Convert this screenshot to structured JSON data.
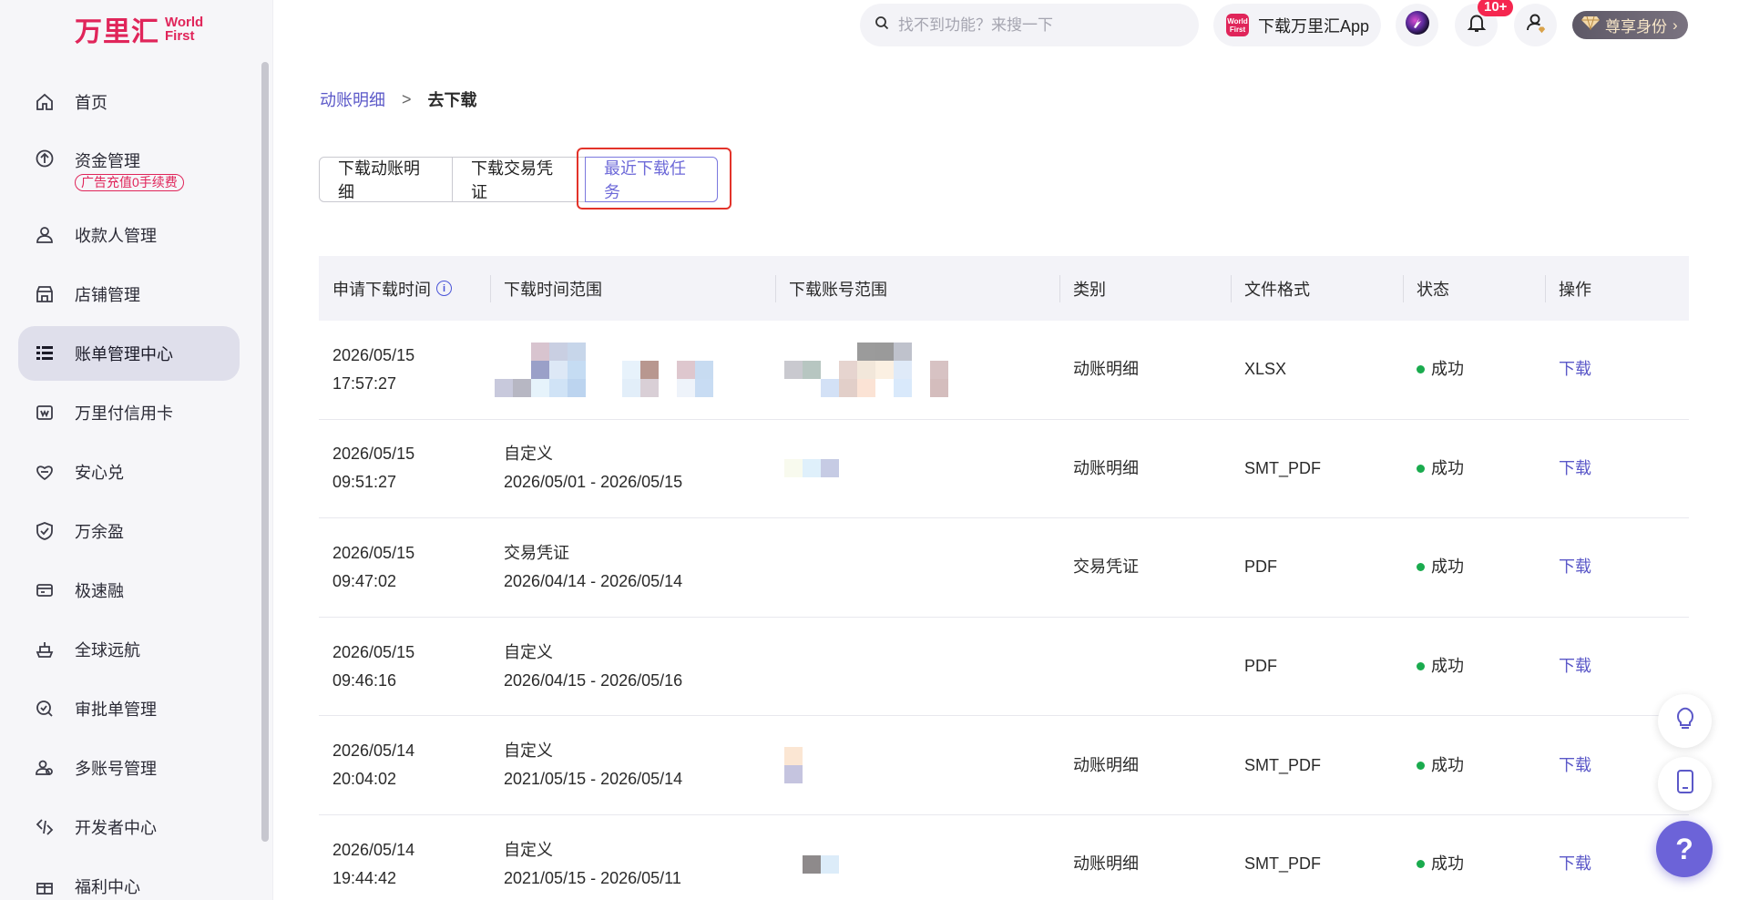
{
  "brand": {
    "name_cn": "万里汇",
    "name_en_line1": "World",
    "name_en_line2": "First"
  },
  "sidebar": {
    "items": [
      {
        "label": "首页",
        "icon": "home-icon"
      },
      {
        "label": "资金管理",
        "badge": "广告充值0手续费",
        "icon": "fund-icon"
      },
      {
        "label": "收款人管理",
        "icon": "payee-icon"
      },
      {
        "label": "店铺管理",
        "icon": "store-icon"
      },
      {
        "label": "账单管理中心",
        "icon": "list-icon",
        "active": true
      },
      {
        "label": "万里付信用卡",
        "icon": "credit-card-icon"
      },
      {
        "label": "安心兑",
        "icon": "exchange-icon"
      },
      {
        "label": "万余盈",
        "icon": "shield-icon"
      },
      {
        "label": "极速融",
        "icon": "finance-icon"
      },
      {
        "label": "全球远航",
        "icon": "ship-icon"
      },
      {
        "label": "审批单管理",
        "icon": "approval-icon"
      },
      {
        "label": "多账号管理",
        "icon": "multi-account-icon"
      },
      {
        "label": "开发者中心",
        "icon": "developer-icon"
      },
      {
        "label": "福利中心",
        "icon": "gift-icon"
      }
    ]
  },
  "topbar": {
    "search_placeholder": "找不到功能？来搜一下",
    "app_download": "下载万里汇App",
    "app_logo_text": "World First",
    "notification_count": "10+",
    "vip_label": "尊享身份"
  },
  "breadcrumb": {
    "parent": "动账明细",
    "separator": ">",
    "current": "去下载"
  },
  "tabs": [
    {
      "label": "下载动账明细"
    },
    {
      "label": "下载交易凭证"
    },
    {
      "label": "最近下载任务",
      "active": true
    }
  ],
  "table": {
    "headers": [
      "申请下载时间",
      "下载时间范围",
      "下载账号范围",
      "类别",
      "文件格式",
      "状态",
      "操作"
    ],
    "rows": [
      {
        "date": "2026/05/15",
        "time": "17:57:27",
        "range_type": "",
        "range": "",
        "category": "动账明细",
        "format": "XLSX",
        "status": "成功",
        "action": "下载"
      },
      {
        "date": "2026/05/15",
        "time": "09:51:27",
        "range_type": "自定义",
        "range": "2026/05/01 - 2026/05/15",
        "category": "动账明细",
        "format": "SMT_PDF",
        "status": "成功",
        "action": "下载"
      },
      {
        "date": "2026/05/15",
        "time": "09:47:02",
        "range_type": "交易凭证",
        "range": "2026/04/14 - 2026/05/14",
        "category": "交易凭证",
        "format": "PDF",
        "status": "成功",
        "action": "下载"
      },
      {
        "date": "2026/05/15",
        "time": "09:46:16",
        "range_type": "自定义",
        "range": "2026/04/15 - 2026/05/16",
        "category": "",
        "format": "PDF",
        "status": "成功",
        "action": "下载"
      },
      {
        "date": "2026/05/14",
        "time": "20:04:02",
        "range_type": "自定义",
        "range": "2021/05/15 - 2026/05/14",
        "category": "动账明细",
        "format": "SMT_PDF",
        "status": "成功",
        "action": "下载"
      },
      {
        "date": "2026/05/14",
        "time": "19:44:42",
        "range_type": "自定义",
        "range": "2021/05/15 - 2026/05/11",
        "category": "动账明细",
        "format": "SMT_PDF",
        "status": "成功",
        "action": "下载"
      }
    ]
  },
  "floating": {
    "help_label": "?"
  },
  "colors": {
    "brand": "#e0255a",
    "accent": "#5b58c8",
    "success": "#1aab4e",
    "highlight": "#e3332a"
  }
}
